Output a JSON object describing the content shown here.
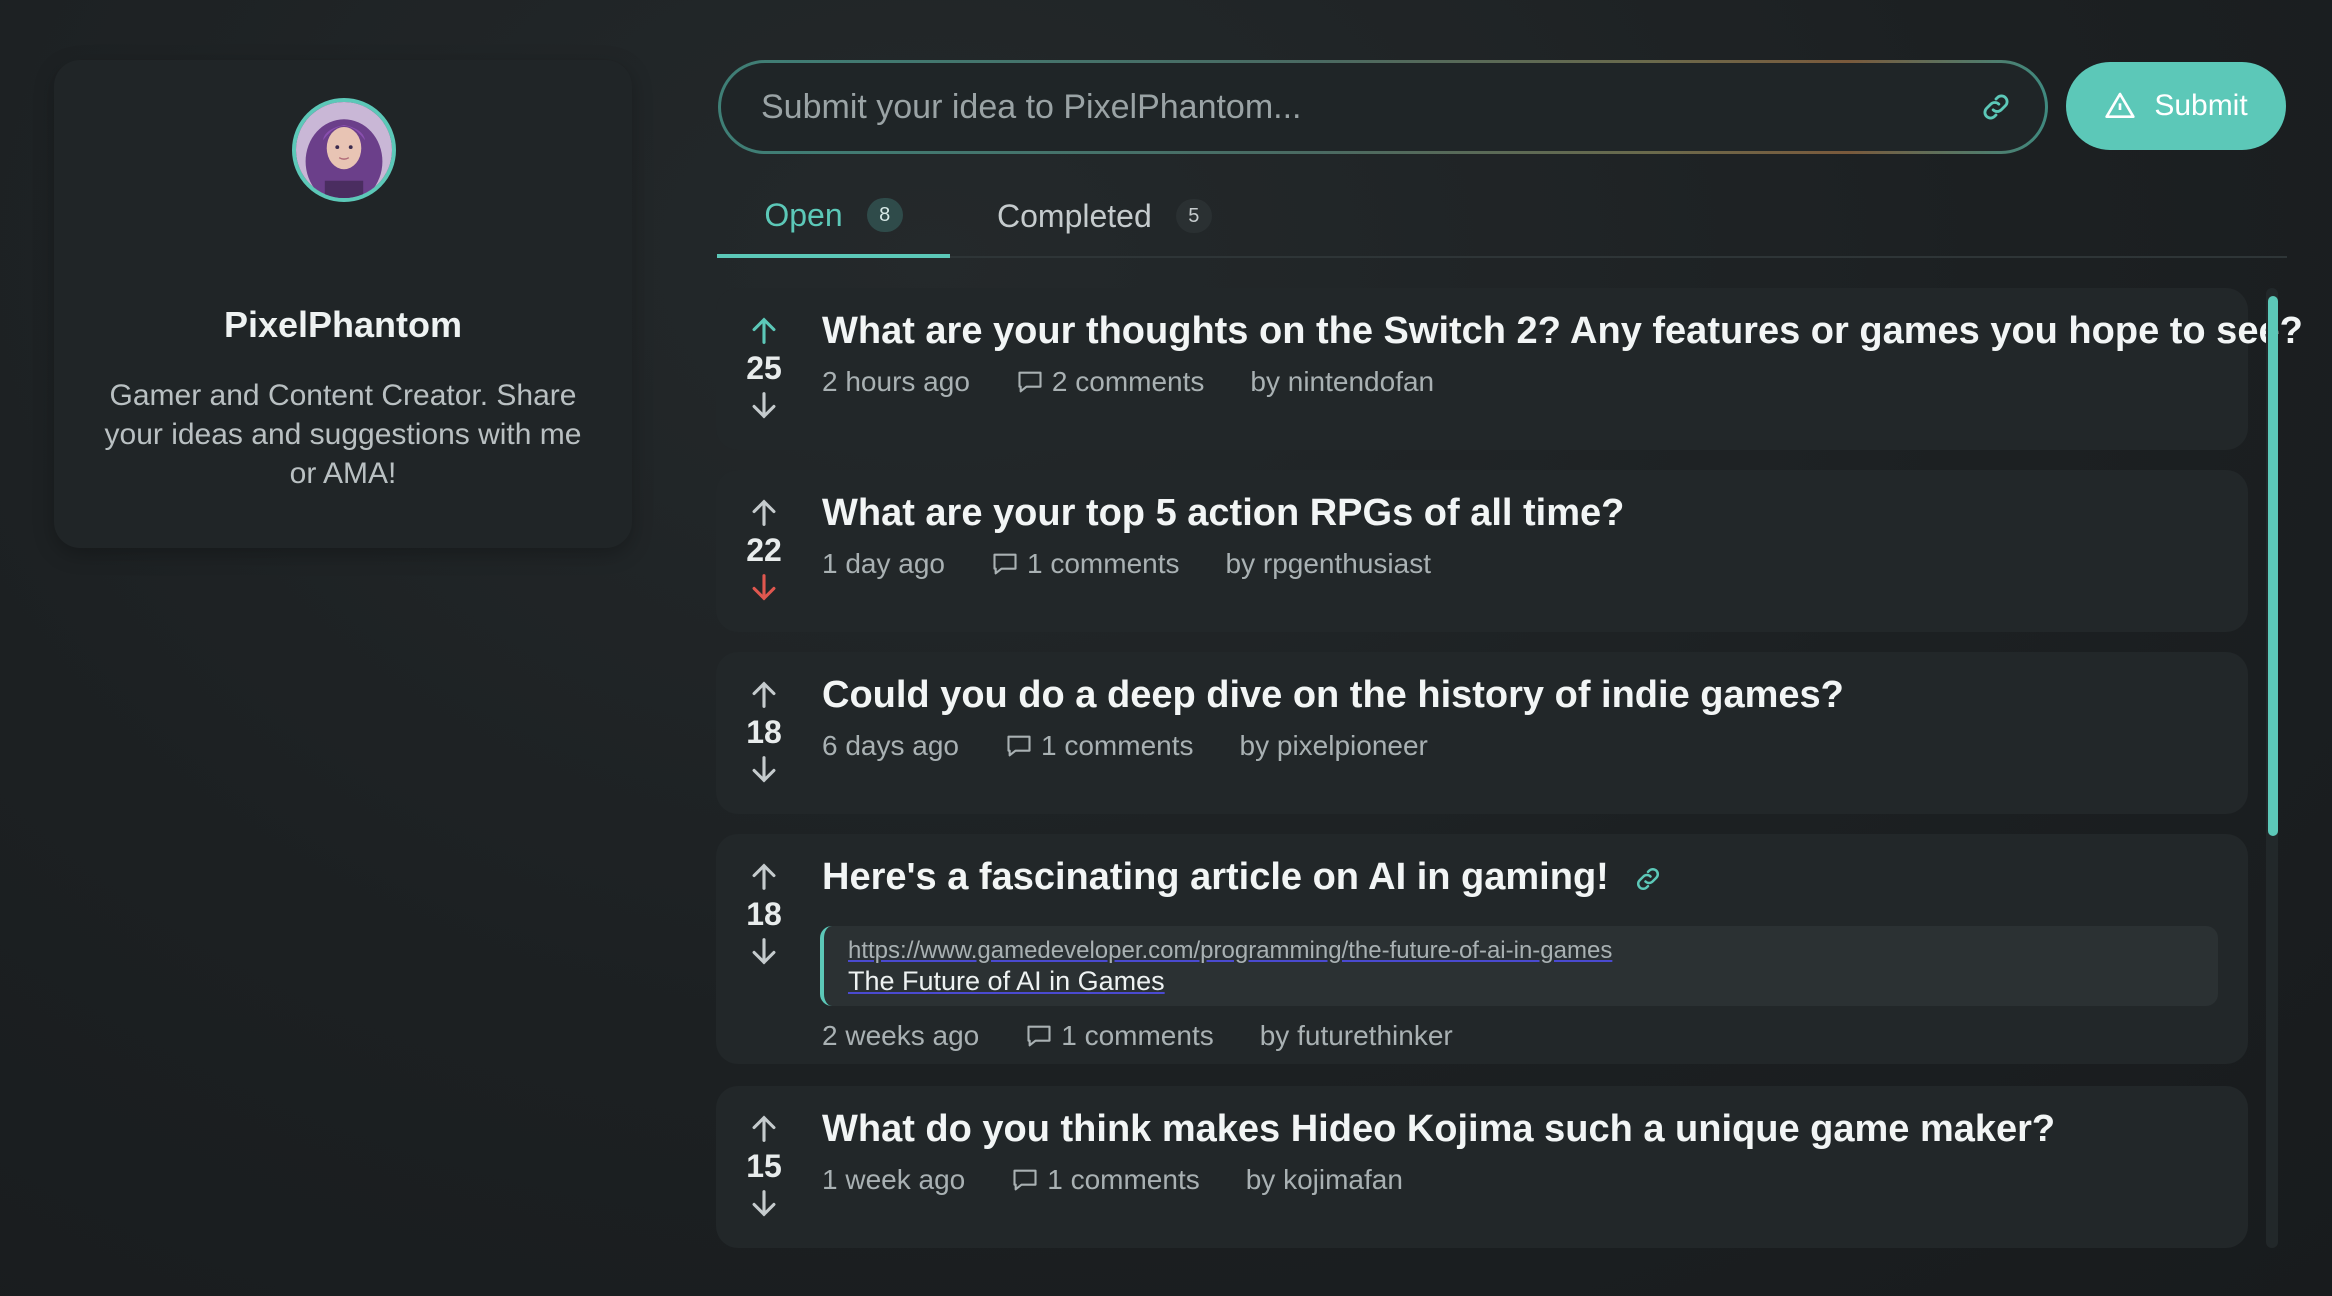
{
  "profile": {
    "name": "PixelPhantom",
    "bio": "Gamer and Content Creator. Share your ideas and suggestions with me or AMA!",
    "socials": [
      {
        "icon": "youtube-icon"
      },
      {
        "icon": "instagram-icon"
      },
      {
        "icon": "twitch-icon"
      },
      {
        "icon": "x-icon"
      },
      {
        "icon": "bluesky-icon"
      }
    ]
  },
  "submit": {
    "placeholder": "Submit your idea to PixelPhantom...",
    "value": "",
    "button_label": "Submit"
  },
  "tabs": [
    {
      "label": "Open",
      "count": "8",
      "active": true
    },
    {
      "label": "Completed",
      "count": "5",
      "active": false
    }
  ],
  "ideas": [
    {
      "votes": "25",
      "title": "What are your thoughts on the Switch 2? Any features or games you hope to see?",
      "time": "2 hours ago",
      "comments_count": "2",
      "comments_label": "comments",
      "author": "by nintendofan",
      "upvoted": true,
      "downvoted": false
    },
    {
      "votes": "22",
      "title": "What are your top 5 action RPGs of all time?",
      "time": "1 day ago",
      "comments_count": "1",
      "comments_label": "comments",
      "author": "by rpgenthusiast",
      "upvoted": false,
      "downvoted": true
    },
    {
      "votes": "18",
      "title": "Could you do a deep dive on the history of indie games?",
      "time": "6 days ago",
      "comments_count": "1",
      "comments_label": "comments",
      "author": "by pixelpioneer",
      "upvoted": false,
      "downvoted": false
    },
    {
      "votes": "18",
      "title": "Here's a fascinating article on AI in gaming!",
      "time": "2 weeks ago",
      "comments_count": "1",
      "comments_label": "comments",
      "author": "by futurethinker",
      "upvoted": false,
      "downvoted": false,
      "link": {
        "url": "https://www.gamedeveloper.com/programming/the-future-of-ai-in-games",
        "title": "The Future of AI in Games"
      }
    },
    {
      "votes": "15",
      "title": "What do you think makes Hideo Kojima such a unique game maker?",
      "time": "1 week ago",
      "comments_count": "1",
      "comments_label": "comments",
      "author": "by kojimafan",
      "upvoted": false,
      "downvoted": false
    }
  ],
  "colors": {
    "accent": "#5cc8b8",
    "downvote_active": "#e0574f",
    "background": "#1c2022",
    "card": "#222729"
  }
}
